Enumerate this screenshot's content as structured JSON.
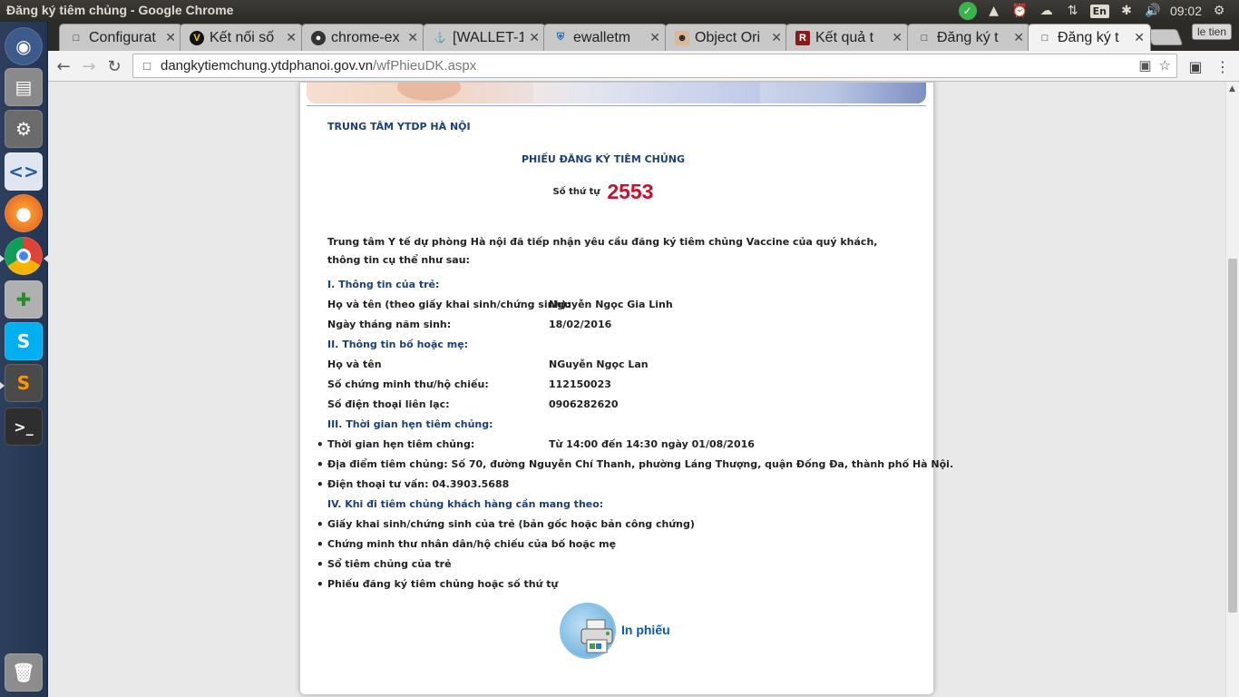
{
  "system": {
    "window_title": "Đăng ký tiêm chủng - Google Chrome",
    "keyboard_layout": "En",
    "clock": "09:02"
  },
  "browser": {
    "tabs": [
      {
        "title": "Configurat",
        "icon": "page-icon"
      },
      {
        "title": "Kết nối số",
        "icon": "v-logo-icon"
      },
      {
        "title": "chrome-ex",
        "icon": "github-icon"
      },
      {
        "title": "[WALLET-1",
        "icon": "jira-icon"
      },
      {
        "title": "ewalletm",
        "icon": "shield-icon"
      },
      {
        "title": "Object Ori",
        "icon": "avatar-icon"
      },
      {
        "title": "Kết quả t",
        "icon": "r-logo-icon"
      },
      {
        "title": "Đăng ký t",
        "icon": "page-icon"
      },
      {
        "title": "Đăng ký t",
        "icon": "page-icon"
      }
    ],
    "active_tab": 8,
    "profile_name": "le tien",
    "url_host": "dangkytiemchung.ytdphanoi.gov.vn",
    "url_path": "/wfPhieuDK.aspx"
  },
  "page": {
    "org": "TRUNG TÂM YTDP HÀ NỘI",
    "title": "PHIẾU ĐĂNG KÝ TIÊM CHỦNG",
    "queue_label": "Số thứ tự",
    "queue_number": "2553",
    "intro": "Trung tâm Y tế dự phòng Hà nội đã tiếp nhận yêu cầu đăng ký tiêm chủng Vaccine của quý khách, thông tin cụ thể như sau:",
    "section1": {
      "heading": "I.  Thông tin của trẻ:",
      "rows": [
        {
          "label": "Họ và tên (theo giấy khai sinh/chứng sinh):",
          "value": "Nguyễn Ngọc Gia Linh"
        },
        {
          "label": "Ngày tháng năm sinh:",
          "value": "18/02/2016"
        }
      ]
    },
    "section2": {
      "heading": "II.  Thông tin bố hoặc mẹ:",
      "rows": [
        {
          "label": "Họ và tên",
          "value": "NGuyễn Ngọc Lan"
        },
        {
          "label": "Số chứng minh thư/hộ chiếu:",
          "value": "112150023"
        },
        {
          "label": "Số điện thoại liên lạc:",
          "value": "0906282620"
        }
      ]
    },
    "section3": {
      "heading": "III.  Thời gian hẹn tiêm chủng:",
      "appointment_label": "Thời gian hẹn tiêm chủng:",
      "appointment_value": "Từ  14:00  đến  14:30  ngày  01/08/2016",
      "location": "Địa điểm tiêm chủng: Số 70, đường Nguyễn Chí Thanh, phường Láng Thượng, quận Đống Đa, thành phố Hà Nội.",
      "hotline": "Điện thoại tư vấn: 04.3903.5688"
    },
    "section4": {
      "heading": "IV. Khi đi tiêm chủng khách hàng cần mang theo:",
      "items": [
        "Giấy khai sinh/chứng sinh của trẻ (bản gốc hoặc bản công chứng)",
        "Chứng minh thư nhân dân/hộ chiếu của bố hoặc mẹ",
        "Sổ tiêm chủng của trẻ",
        "Phiếu đăng ký tiêm chủng hoặc số thứ tự"
      ]
    },
    "print_label": "In phiếu"
  },
  "colors": {
    "heading_blue": "#1c3f77",
    "queue_red": "#c8102e",
    "link_blue": "#0a5aa8"
  }
}
